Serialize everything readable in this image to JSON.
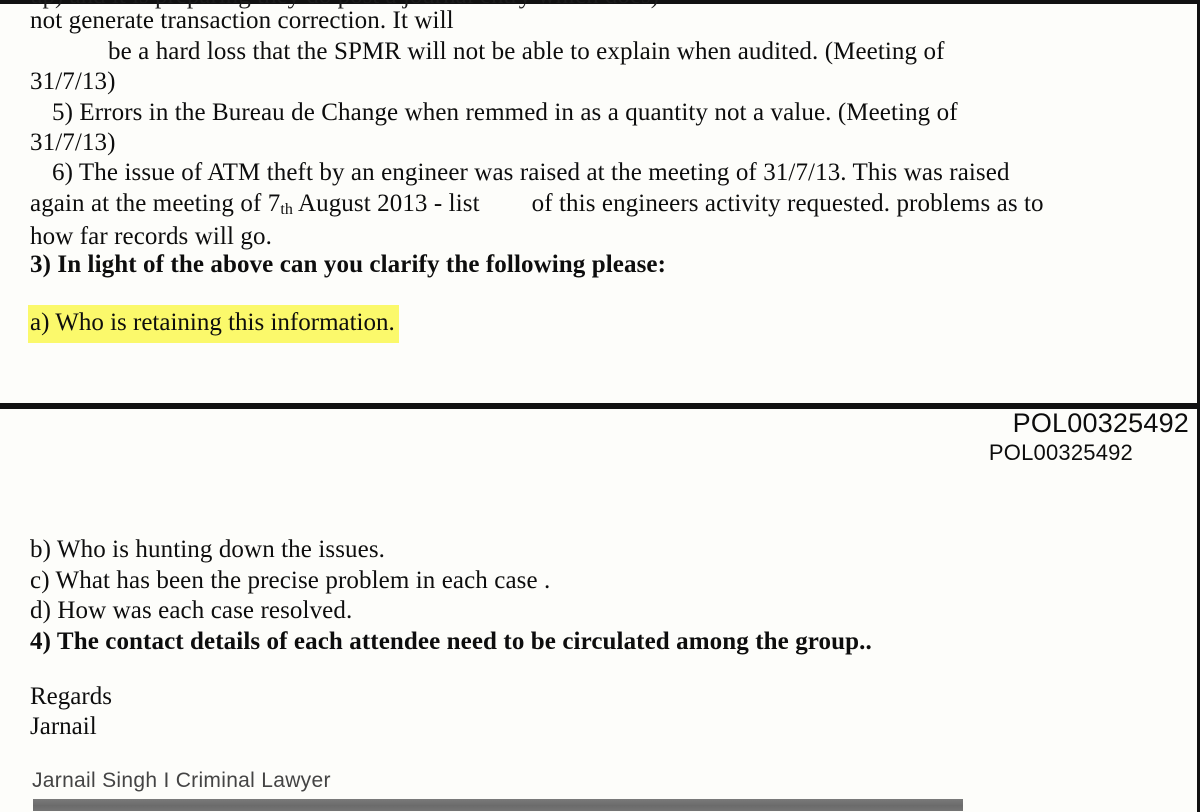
{
  "document": {
    "clipped_top_line": "up) and it is preparing they do post a journal entry which does)",
    "paragraphs": [
      {
        "id": "p4-cont",
        "text": "not generate transaction correction. It will",
        "indent": "none",
        "bold": false
      },
      {
        "id": "p4-cont2",
        "text": "be a hard loss  that the SPMR will not be able to explain when audited. (Meeting of",
        "indent": "large",
        "bold": false
      },
      {
        "id": "p4-date",
        "text": "31/7/13)",
        "indent": "none",
        "bold": false
      },
      {
        "id": "p5",
        "text": "5) Errors in the Bureau de Change when remmed in as a quantity not a value. (Meeting of",
        "indent": "small",
        "bold": false
      },
      {
        "id": "p5-date",
        "text": "31/7/13)",
        "indent": "none",
        "bold": false
      }
    ],
    "item6": {
      "line1": "6) The issue of ATM theft by an engineer was raised at the meeting of 31/7/13. This was raised",
      "line2_before": "again at the meeting of 7",
      "line2_superscript": "th",
      "line2_middle": " August 2013 - list",
      "line2_after": "of this engineers activity requested. problems as to",
      "line3": "how far records will go."
    },
    "item3_heading": "3)  In light of the above can you clarify the following please:",
    "highlighted_item": "a) Who is retaining this information.",
    "lower_items": [
      {
        "id": "b",
        "text": "b) Who is hunting down the issues.",
        "bold": false
      },
      {
        "id": "c",
        "text": "c) What has been the precise problem in each case .",
        "bold": false
      },
      {
        "id": "d",
        "text": "d) How was each case resolved.",
        "bold": false
      },
      {
        "id": "4",
        "text": "4) The contact details of each attendee need to be circulated among the group..",
        "bold": true
      }
    ],
    "signoff": {
      "closing": "Regards",
      "name": "Jarnail"
    },
    "footer_signature": "Jarnail Singh I Criminal Lawyer",
    "reference_large": "POL00325492",
    "reference_small": "POL00325492"
  },
  "colors": {
    "highlight": "#fbf96b",
    "page_background": "#fdfdfa",
    "ink": "#0d0d0d",
    "divider": "#111111",
    "gray_bar": "#6e6e6e"
  }
}
